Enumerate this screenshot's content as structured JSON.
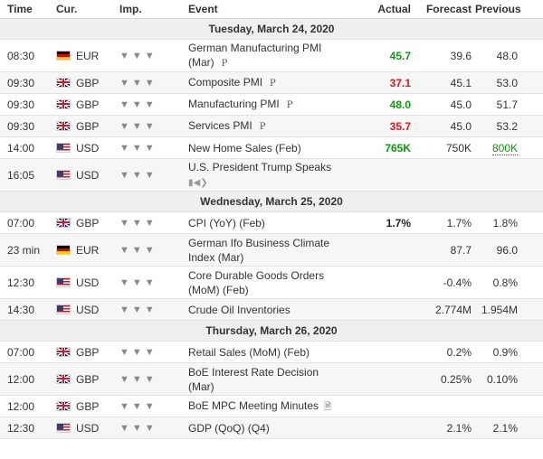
{
  "header": {
    "time": "Time",
    "currency": "Cur.",
    "importance": "Imp.",
    "event": "Event",
    "actual": "Actual",
    "forecast": "Forecast",
    "previous": "Previous"
  },
  "groups": [
    {
      "date": "Tuesday, March 24, 2020",
      "events": [
        {
          "time": "08:30",
          "flag": "de",
          "currency": "EUR",
          "event": "German Manufacturing PMI (Mar)",
          "tag": "P",
          "actual": "45.7",
          "actual_color": "#0c9a0c",
          "forecast": "39.6",
          "previous": "48.0",
          "tall": true
        },
        {
          "time": "09:30",
          "flag": "gb",
          "currency": "GBP",
          "event": "Composite PMI",
          "tag": "P",
          "actual": "37.1",
          "actual_color": "#e0151a",
          "forecast": "45.1",
          "previous": "53.0"
        },
        {
          "time": "09:30",
          "flag": "gb",
          "currency": "GBP",
          "event": "Manufacturing PMI",
          "tag": "P",
          "actual": "48.0",
          "actual_color": "#0c9a0c",
          "forecast": "45.0",
          "previous": "51.7"
        },
        {
          "time": "09:30",
          "flag": "gb",
          "currency": "GBP",
          "event": "Services PMI",
          "tag": "P",
          "actual": "35.7",
          "actual_color": "#e0151a",
          "forecast": "45.0",
          "previous": "53.2"
        },
        {
          "time": "14:00",
          "flag": "us",
          "currency": "USD",
          "event": "New Home Sales (Feb)",
          "actual": "765K",
          "actual_color": "#0c9a0c",
          "forecast": "750K",
          "previous": "800K",
          "previous_revised": true
        },
        {
          "time": "16:05",
          "flag": "us",
          "currency": "USD",
          "event": "U.S. President Trump Speaks",
          "speech": true,
          "actual": "",
          "forecast": "",
          "previous": "",
          "tall": true
        }
      ]
    },
    {
      "date": "Wednesday, March 25, 2020",
      "events": [
        {
          "time": "07:00",
          "flag": "gb",
          "currency": "GBP",
          "event": "CPI (YoY) (Feb)",
          "actual": "1.7%",
          "actual_color": "#222222",
          "forecast": "1.7%",
          "previous": "1.8%"
        },
        {
          "time": "23 min",
          "flag": "de",
          "currency": "EUR",
          "event": "German Ifo Business Climate Index (Mar)",
          "actual": "",
          "forecast": "87.7",
          "previous": "96.0",
          "tall": true
        },
        {
          "time": "12:30",
          "flag": "us",
          "currency": "USD",
          "event": "Core Durable Goods Orders (MoM) (Feb)",
          "actual": "",
          "forecast": "-0.4%",
          "previous": "0.8%",
          "tall": true
        },
        {
          "time": "14:30",
          "flag": "us",
          "currency": "USD",
          "event": "Crude Oil Inventories",
          "actual": "",
          "forecast": "2.774M",
          "previous": "1.954M"
        }
      ]
    },
    {
      "date": "Thursday, March 26, 2020",
      "events": [
        {
          "time": "07:00",
          "flag": "gb",
          "currency": "GBP",
          "event": "Retail Sales (MoM) (Feb)",
          "actual": "",
          "forecast": "0.2%",
          "previous": "0.9%"
        },
        {
          "time": "12:00",
          "flag": "gb",
          "currency": "GBP",
          "event": "BoE Interest Rate Decision (Mar)",
          "actual": "",
          "forecast": "0.25%",
          "previous": "0.10%",
          "tall": true
        },
        {
          "time": "12:00",
          "flag": "gb",
          "currency": "GBP",
          "event": "BoE MPC Meeting Minutes",
          "doc": true,
          "actual": "",
          "forecast": "",
          "previous": ""
        },
        {
          "time": "12:30",
          "flag": "us",
          "currency": "USD",
          "event": "GDP (QoQ) (Q4)",
          "actual": "",
          "forecast": "2.1%",
          "previous": "2.1%"
        }
      ]
    }
  ],
  "icons": {
    "importance": "bull-icon",
    "speech": "speaker-icon",
    "document": "document-icon"
  },
  "colors": {
    "positive": "#0c9a0c",
    "negative": "#e0151a",
    "date_row_bg": "#efefef"
  }
}
